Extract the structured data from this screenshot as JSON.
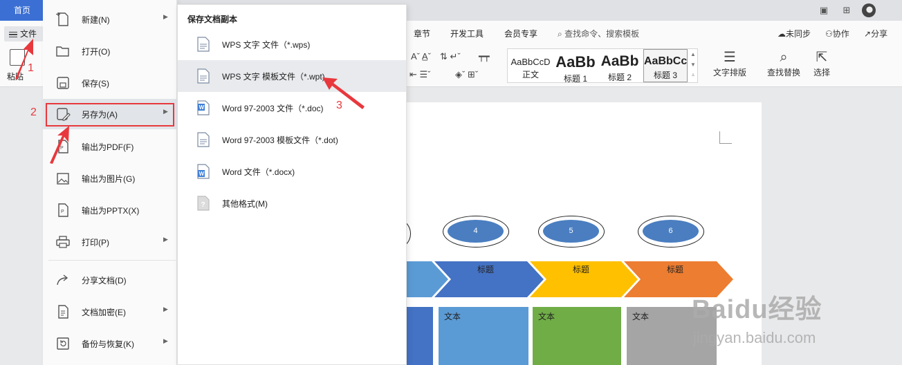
{
  "tabs": {
    "home": "首页"
  },
  "menubar": {
    "file_label": "文件",
    "tabs": [
      "章节",
      "开发工具",
      "会员专享"
    ],
    "search_placeholder": "查找命令、搜索模板",
    "unsynced": "未同步",
    "collab": "协作",
    "share": "分享"
  },
  "ribbon": {
    "paste": "粘贴",
    "styles": [
      {
        "sample": "AaBbCcD",
        "name": "正文"
      },
      {
        "sample": "AaBb",
        "name": "标题 1"
      },
      {
        "sample": "AaBb",
        "name": "标题 2"
      },
      {
        "sample": "AaBbCc",
        "name": "标题 3"
      }
    ],
    "text_layout": "文字排版",
    "find_replace": "查找替换",
    "select": "选择"
  },
  "file_menu": {
    "items": [
      {
        "label": "新建(N)",
        "icon": "new-doc-icon",
        "has_arrow": true
      },
      {
        "label": "打开(O)",
        "icon": "folder-open-icon",
        "has_arrow": false
      },
      {
        "label": "保存(S)",
        "icon": "save-icon",
        "has_arrow": false
      },
      {
        "label": "另存为(A)",
        "icon": "save-as-icon",
        "has_arrow": true
      },
      {
        "label": "输出为PDF(F)",
        "icon": "export-pdf-icon",
        "has_arrow": false
      },
      {
        "label": "输出为图片(G)",
        "icon": "export-image-icon",
        "has_arrow": false
      },
      {
        "label": "输出为PPTX(X)",
        "icon": "export-pptx-icon",
        "has_arrow": false
      },
      {
        "label": "打印(P)",
        "icon": "print-icon",
        "has_arrow": true
      },
      {
        "label": "分享文档(D)",
        "icon": "share-doc-icon",
        "has_arrow": false
      },
      {
        "label": "文档加密(E)",
        "icon": "encrypt-doc-icon",
        "has_arrow": true
      },
      {
        "label": "备份与恢复(K)",
        "icon": "backup-restore-icon",
        "has_arrow": true
      }
    ]
  },
  "save_as_menu": {
    "heading": "保存文档副本",
    "items": [
      {
        "label": "WPS 文字 文件（*.wps)",
        "icon": "wps-file-icon"
      },
      {
        "label": "WPS 文字 模板文件（*.wpt)",
        "icon": "wps-template-icon"
      },
      {
        "label": "Word 97-2003 文件（*.doc)",
        "icon": "word-doc-icon"
      },
      {
        "label": "Word 97-2003 模板文件（*.dot)",
        "icon": "word-template-icon"
      },
      {
        "label": "Word 文件（*.docx)",
        "icon": "word-docx-icon"
      },
      {
        "label": "其他格式(M)",
        "icon": "other-format-icon"
      }
    ]
  },
  "annotations": {
    "step1": "1",
    "step2": "2",
    "step3": "3"
  },
  "document": {
    "ovals": [
      "4",
      "5",
      "6"
    ],
    "arrow_titles": [
      "标题",
      "标题",
      "标题"
    ],
    "box_texts": [
      "文本",
      "文本",
      "文本"
    ],
    "colors": {
      "blue": "#4472c4",
      "light_blue": "#5b9bd5",
      "yellow": "#ffc000",
      "orange": "#ed7d31",
      "green": "#70ad47",
      "gray": "#a5a5a5"
    }
  },
  "watermark": {
    "brand": "Baidu经验",
    "url": "jingyan.baidu.com"
  }
}
